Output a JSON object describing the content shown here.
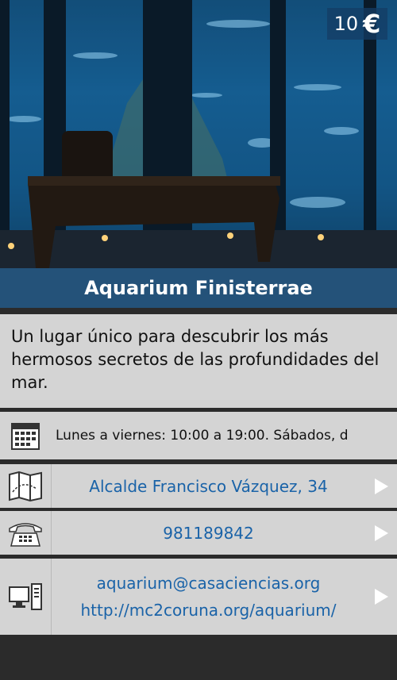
{
  "place": {
    "price": "10",
    "currency_symbol": "€",
    "title": "Aquarium Finisterrae",
    "description": "Un lugar único para descubrir los más hermosos secretos de las profundidades del mar."
  },
  "info": {
    "hours": "Lunes a viernes: 10:00 a 19:00. Sábados, d",
    "address": "Alcalde Francisco Vázquez, 34",
    "phone": "981189842",
    "email": "aquarium@casaciencias.org",
    "website": "http://mc2coruna.org/aquarium/"
  },
  "icons": {
    "hours": "calendar-icon",
    "address": "map-icon",
    "phone": "phone-icon",
    "web": "computer-icon",
    "arrow": "play-arrow-icon"
  },
  "colors": {
    "panel_bg": "#d4d4d4",
    "link": "#1a63a8",
    "title_bar": "#2a6aa0",
    "page_bg": "#2b2b2b"
  }
}
